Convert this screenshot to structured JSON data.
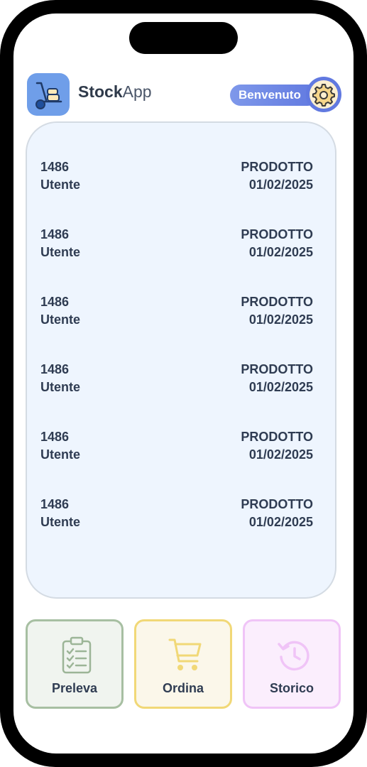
{
  "app": {
    "name_bold": "Stock",
    "name_light": "App",
    "logo_icon": "hand-truck-icon"
  },
  "header": {
    "welcome": "Benvenuto",
    "settings_icon": "gear-icon"
  },
  "list": {
    "items": [
      {
        "id": "1486",
        "user": "Utente",
        "type": "PRODOTTO",
        "date": "01/02/2025"
      },
      {
        "id": "1486",
        "user": "Utente",
        "type": "PRODOTTO",
        "date": "01/02/2025"
      },
      {
        "id": "1486",
        "user": "Utente",
        "type": "PRODOTTO",
        "date": "01/02/2025"
      },
      {
        "id": "1486",
        "user": "Utente",
        "type": "PRODOTTO",
        "date": "01/02/2025"
      },
      {
        "id": "1486",
        "user": "Utente",
        "type": "PRODOTTO",
        "date": "01/02/2025"
      },
      {
        "id": "1486",
        "user": "Utente",
        "type": "PRODOTTO",
        "date": "01/02/2025"
      }
    ]
  },
  "actions": {
    "preleva": {
      "label": "Preleva",
      "icon": "clipboard-checklist-icon"
    },
    "ordina": {
      "label": "Ordina",
      "icon": "shopping-cart-icon"
    },
    "storico": {
      "label": "Storico",
      "icon": "history-icon"
    }
  },
  "colors": {
    "accent": "#6179e0",
    "preleva": "#a7bfa2",
    "ordina": "#f1d877",
    "storico": "#f0c4f7"
  }
}
